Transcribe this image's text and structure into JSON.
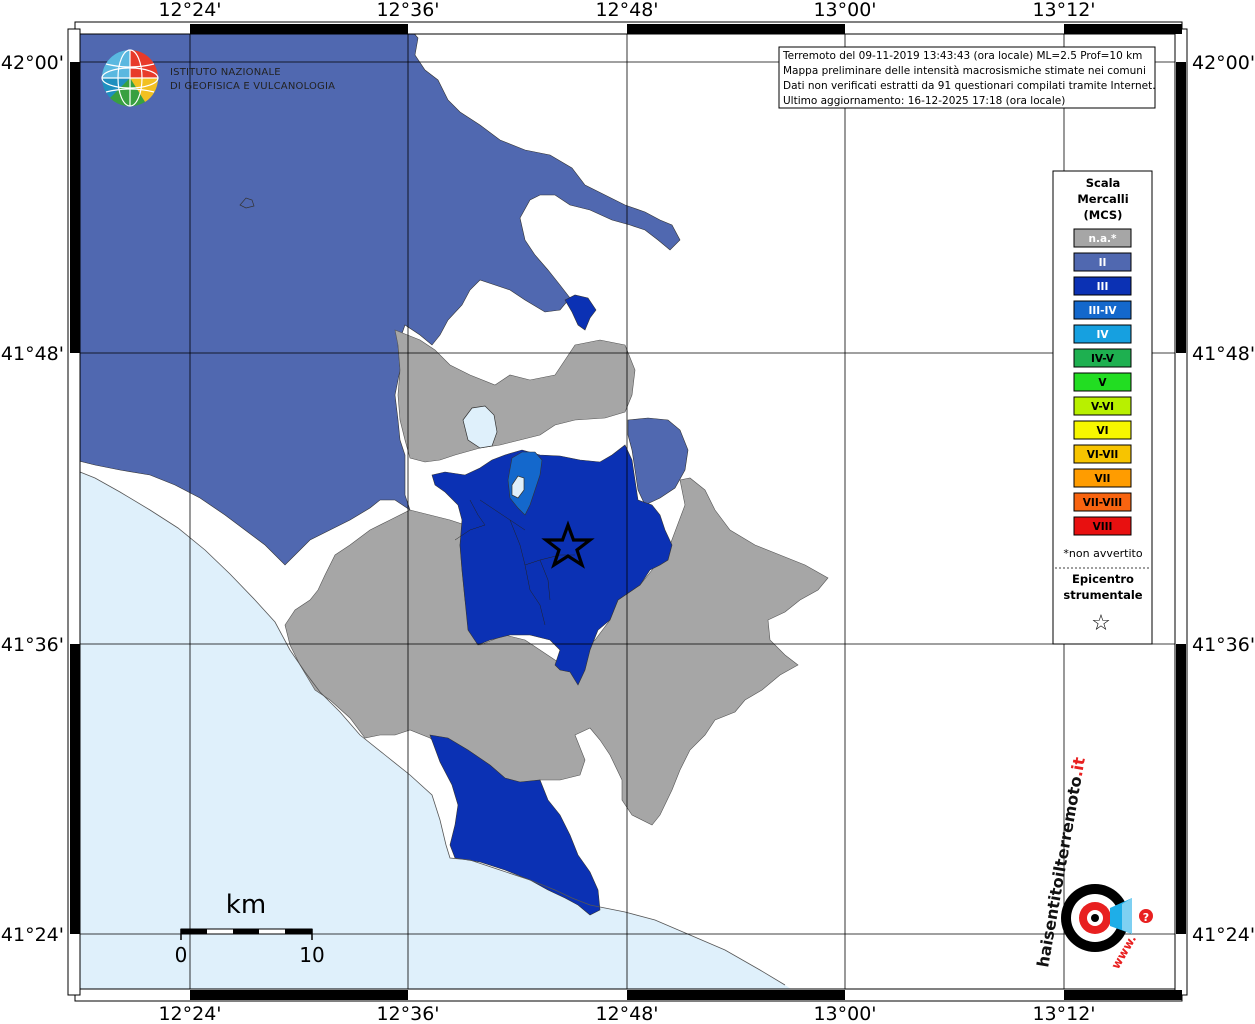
{
  "map": {
    "lat_labels": [
      "42°00'",
      "41°48'",
      "41°36'",
      "41°24'"
    ],
    "lon_labels": [
      "12°24'",
      "12°36'",
      "12°48'",
      "13°00'",
      "13°12'"
    ]
  },
  "info_box": {
    "line1": "Terremoto del 09-11-2019 13:43:43 (ora locale) ML=2.5 Prof=10 km",
    "line2": "Mappa preliminare delle intensità macrosismiche stimate nei comuni",
    "line3": "Dati non verificati estratti da 91 questionari compilati tramite Internet.",
    "line4": "Ultimo aggiornamento: 16-12-2025 17:18 (ora locale)"
  },
  "ingv": {
    "line1": "ISTITUTO NAZIONALE",
    "line2": "DI GEOFISICA E VULCANOLOGIA"
  },
  "legend": {
    "title1": "Scala",
    "title2": "Mercalli",
    "title3": "(MCS)",
    "items": [
      {
        "label": "n.a.*",
        "color": "#a6a6a6",
        "text_color": "#ffffff"
      },
      {
        "label": "II",
        "color": "#5068b0",
        "text_color": "#ffffff"
      },
      {
        "label": "III",
        "color": "#0b31b4",
        "text_color": "#ffffff"
      },
      {
        "label": "III-IV",
        "color": "#1468cc",
        "text_color": "#ffffff"
      },
      {
        "label": "IV",
        "color": "#16a0e0",
        "text_color": "#ffffff"
      },
      {
        "label": "IV-V",
        "color": "#1eb050",
        "text_color": "#000000"
      },
      {
        "label": "V",
        "color": "#22dd22",
        "text_color": "#000000"
      },
      {
        "label": "V-VI",
        "color": "#b8f000",
        "text_color": "#000000"
      },
      {
        "label": "VI",
        "color": "#f7f700",
        "text_color": "#000000"
      },
      {
        "label": "VI-VII",
        "color": "#f7c400",
        "text_color": "#000000"
      },
      {
        "label": "VII",
        "color": "#ff9c00",
        "text_color": "#000000"
      },
      {
        "label": "VII-VIII",
        "color": "#f86410",
        "text_color": "#000000"
      },
      {
        "label": "VIII",
        "color": "#e81010",
        "text_color": "#000000"
      }
    ],
    "note": "*non avvertito",
    "epi1": "Epicentro",
    "epi2": "strumentale",
    "epi_symbol": "☆"
  },
  "scale_bar": {
    "unit": "km",
    "min": "0",
    "max": "10"
  },
  "badge": {
    "text_main": "haisentitoilterremoto",
    "text_suffix": ".it",
    "text_www": "www.",
    "question_mark": "?"
  },
  "colors": {
    "sea": "#dff0fb",
    "not_felt": "#a6a6a6",
    "mcs_ii": "#5068b0",
    "mcs_iii": "#0b31b4",
    "mcs_iii_iv": "#1468cc",
    "lake": "#dff0fb"
  }
}
